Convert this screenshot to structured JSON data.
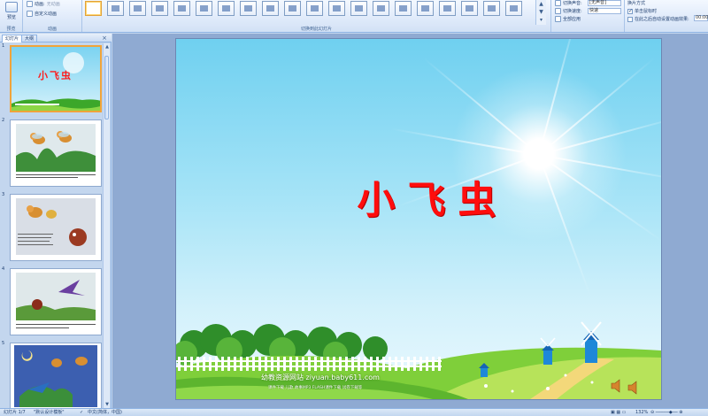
{
  "ribbon": {
    "preview_label": "预览",
    "preview_group_label": "预览",
    "animate_label": "动画:",
    "animate_value": "无动画",
    "custom_anim_label": "自定义动画",
    "anim_group_label": "动画",
    "transition_group_label": "切换到此幻灯片",
    "sound_label": "切换声音:",
    "sound_value": "[无声音]",
    "speed_label": "切换速度:",
    "speed_value": "快速",
    "apply_all_label": "全部应用",
    "advance_group_label": "换片方式",
    "on_click_label": "单击鼠标时",
    "after_label": "在此之后自动设置动画效果:",
    "after_value": "00:00"
  },
  "left_pane": {
    "tab_slides": "幻灯片",
    "tab_outline": "大纲",
    "close_glyph": "×",
    "thumbnails": [
      {
        "num": "1",
        "title": "小飞虫"
      },
      {
        "num": "2"
      },
      {
        "num": "3"
      },
      {
        "num": "4"
      },
      {
        "num": "5"
      }
    ]
  },
  "slide": {
    "title": "小飞虫",
    "site_text": "幼教资源网站  ziyuan.baby611.com",
    "site_subtext": "课件下载 儿歌 故事MP3 FLASH课件下载 试卷下载等"
  },
  "status": {
    "slide_info": "幻灯片 1/7",
    "theme": "\"默认设计模板\"",
    "language": "中文(简体，中国)",
    "zoom": "132%"
  },
  "colors": {
    "title_red": "#ff0d0d",
    "ribbon_bg": "#dfeafa",
    "editor_bg": "#8faad2",
    "thumb_selected_border": "#f0a43a"
  }
}
